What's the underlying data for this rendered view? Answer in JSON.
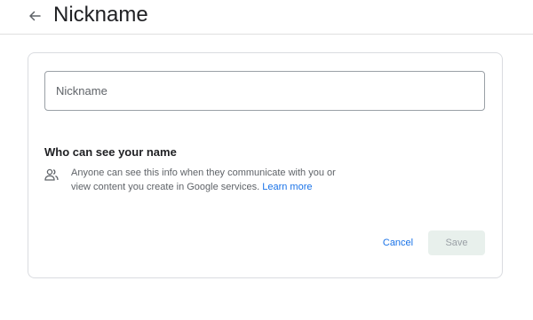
{
  "header": {
    "back_icon": "arrow-back-icon",
    "title": "Nickname"
  },
  "form": {
    "nickname_placeholder": "Nickname",
    "section_heading": "Who can see your name",
    "info_icon": "people-icon",
    "info_text": "Anyone can see this info when they communicate with you or view content you create in Google services. ",
    "learn_more_label": "Learn more",
    "cancel_label": "Cancel",
    "save_label": "Save"
  },
  "colors": {
    "accent": "#1a73e8",
    "save_disabled_bg": "#e8f0ec",
    "text_secondary": "#5f6368"
  }
}
